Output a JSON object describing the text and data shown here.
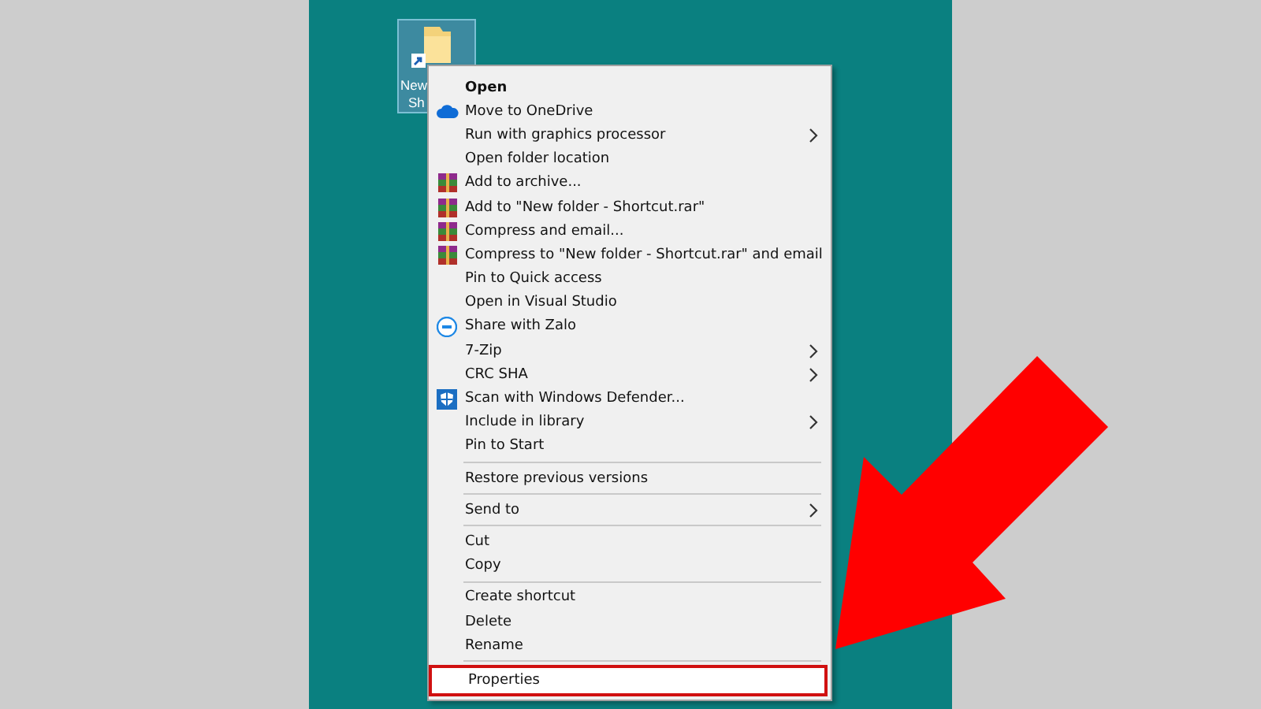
{
  "desktop_icon": {
    "label_lines": [
      "New",
      "Sh"
    ],
    "selected": true
  },
  "context_menu": {
    "items": [
      {
        "kind": "plain",
        "label": "Open",
        "default": true,
        "submenu": false,
        "selected": false
      },
      {
        "kind": "cloud",
        "label": "Move to OneDrive",
        "default": false,
        "submenu": false,
        "selected": false
      },
      {
        "kind": "plain",
        "label": "Run with graphics processor",
        "default": false,
        "submenu": true,
        "selected": false
      },
      {
        "kind": "plain",
        "label": "Open folder location",
        "default": false,
        "submenu": false,
        "selected": false
      },
      {
        "kind": "archive",
        "label": "Add to archive...",
        "default": false,
        "submenu": false,
        "selected": false
      },
      {
        "kind": "archive",
        "label": "Add to \"New folder - Shortcut.rar\"",
        "default": false,
        "submenu": false,
        "selected": false
      },
      {
        "kind": "archive",
        "label": "Compress and email...",
        "default": false,
        "submenu": false,
        "selected": false
      },
      {
        "kind": "archive",
        "label": "Compress to \"New folder - Shortcut.rar\" and email",
        "default": false,
        "submenu": false,
        "selected": false
      },
      {
        "kind": "plain",
        "label": "Pin to Quick access",
        "default": false,
        "submenu": false,
        "selected": false
      },
      {
        "kind": "plain",
        "label": "Open in Visual Studio",
        "default": false,
        "submenu": false,
        "selected": false
      },
      {
        "kind": "chat",
        "label": "Share with Zalo",
        "default": false,
        "submenu": false,
        "selected": false
      },
      {
        "kind": "plain",
        "label": "7-Zip",
        "default": false,
        "submenu": true,
        "selected": false
      },
      {
        "kind": "plain",
        "label": "CRC SHA",
        "default": false,
        "submenu": true,
        "selected": false
      },
      {
        "kind": "shield",
        "label": "Scan with Windows Defender...",
        "default": false,
        "submenu": false,
        "selected": false
      },
      {
        "kind": "plain",
        "label": "Include in library",
        "default": false,
        "submenu": true,
        "selected": false
      },
      {
        "kind": "plain",
        "label": "Pin to Start",
        "default": false,
        "submenu": false,
        "selected": false
      },
      {
        "kind": "separator"
      },
      {
        "kind": "plain",
        "label": "Restore previous versions",
        "default": false,
        "submenu": false,
        "selected": false
      },
      {
        "kind": "separator"
      },
      {
        "kind": "plain",
        "label": "Send to",
        "default": false,
        "submenu": true,
        "selected": false
      },
      {
        "kind": "separator"
      },
      {
        "kind": "plain",
        "label": "Cut",
        "default": false,
        "submenu": false,
        "selected": false
      },
      {
        "kind": "plain",
        "label": "Copy",
        "default": false,
        "submenu": false,
        "selected": false
      },
      {
        "kind": "separator"
      },
      {
        "kind": "plain",
        "label": "Create shortcut",
        "default": false,
        "submenu": false,
        "selected": false
      },
      {
        "kind": "plain",
        "label": "Delete",
        "default": false,
        "submenu": false,
        "selected": false
      },
      {
        "kind": "plain",
        "label": "Rename",
        "default": false,
        "submenu": false,
        "selected": false
      },
      {
        "kind": "separator"
      },
      {
        "kind": "plain",
        "label": "Properties",
        "default": false,
        "submenu": false,
        "selected": true
      }
    ]
  }
}
